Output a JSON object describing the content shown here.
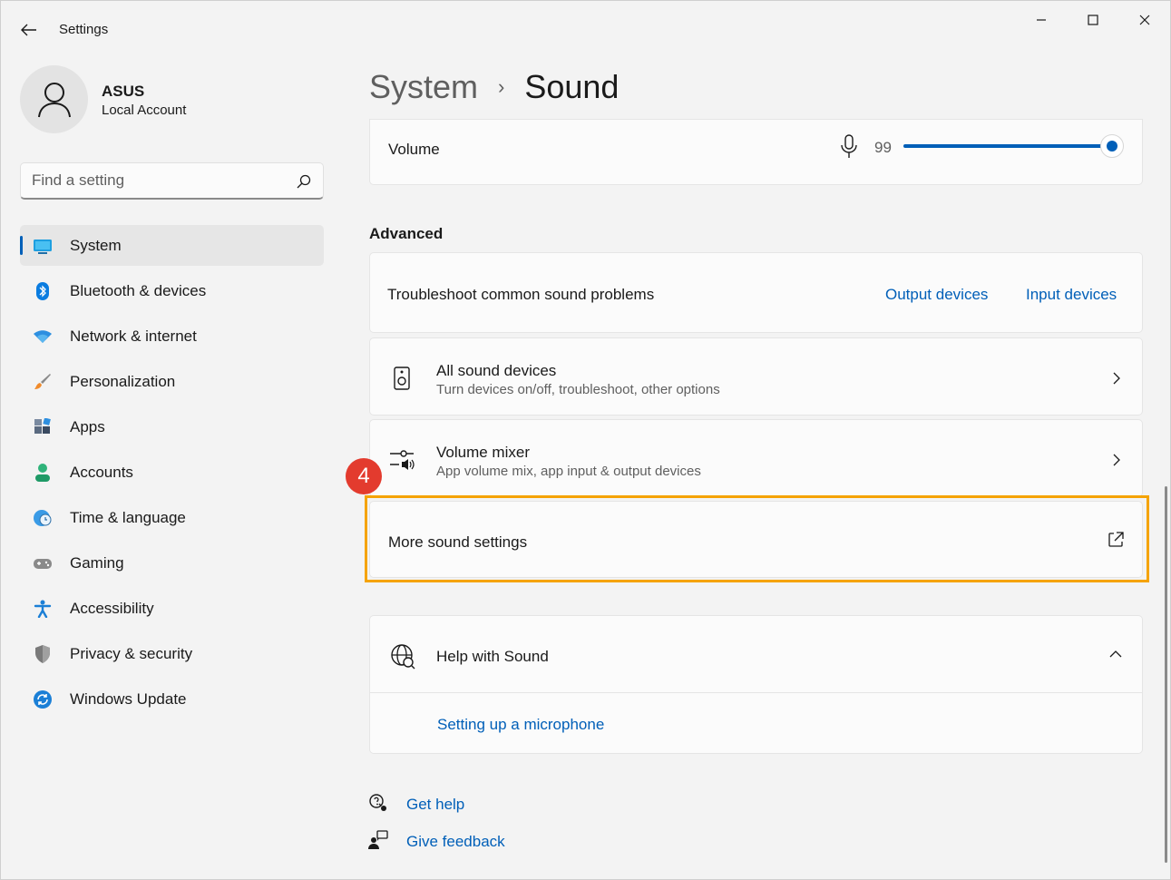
{
  "window": {
    "title": "Settings"
  },
  "user": {
    "name": "ASUS",
    "account_type": "Local Account"
  },
  "search": {
    "placeholder": "Find a setting"
  },
  "nav": {
    "items": [
      {
        "label": "System",
        "icon": "monitor-icon"
      },
      {
        "label": "Bluetooth & devices",
        "icon": "bluetooth-icon"
      },
      {
        "label": "Network & internet",
        "icon": "wifi-icon"
      },
      {
        "label": "Personalization",
        "icon": "brush-icon"
      },
      {
        "label": "Apps",
        "icon": "apps-icon"
      },
      {
        "label": "Accounts",
        "icon": "person-icon"
      },
      {
        "label": "Time & language",
        "icon": "globe-clock-icon"
      },
      {
        "label": "Gaming",
        "icon": "gamepad-icon"
      },
      {
        "label": "Accessibility",
        "icon": "accessibility-icon"
      },
      {
        "label": "Privacy & security",
        "icon": "shield-icon"
      },
      {
        "label": "Windows Update",
        "icon": "update-icon"
      }
    ],
    "active_index": 0
  },
  "header": {
    "parent": "System",
    "separator": "›",
    "current": "Sound"
  },
  "volume": {
    "label": "Volume",
    "value": "99",
    "percent": 99
  },
  "advanced": {
    "title": "Advanced",
    "troubleshoot": {
      "label": "Troubleshoot common sound problems",
      "output_link": "Output devices",
      "input_link": "Input devices"
    },
    "all_devices": {
      "title": "All sound devices",
      "subtitle": "Turn devices on/off, troubleshoot, other options"
    },
    "mixer": {
      "title": "Volume mixer",
      "subtitle": "App volume mix, app input & output devices"
    },
    "more": {
      "label": "More sound settings"
    }
  },
  "annotation": {
    "step": "4"
  },
  "help": {
    "title": "Help with Sound",
    "link": "Setting up a microphone"
  },
  "footer": {
    "get_help": "Get help",
    "feedback": "Give feedback"
  },
  "colors": {
    "accent": "#005fb8",
    "highlight": "#f5a300",
    "badge": "#e33b2e"
  }
}
